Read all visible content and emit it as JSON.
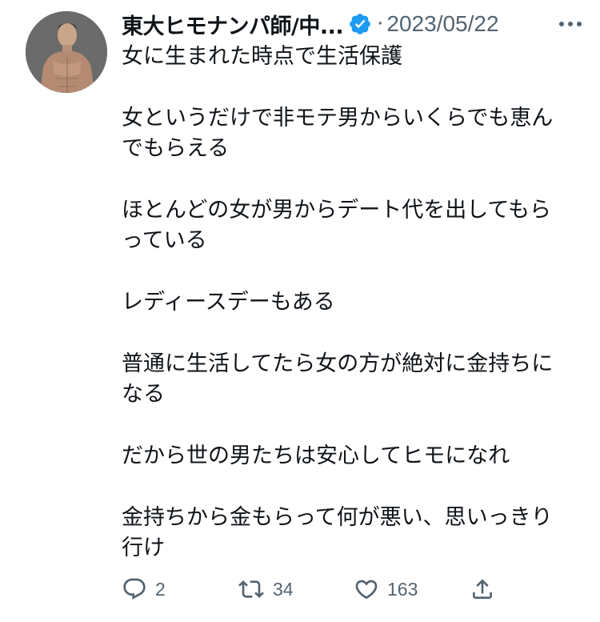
{
  "tweet": {
    "author_name": "東大ヒモナンパ師/中...",
    "separator": "·",
    "date": "2023/05/22",
    "verified_icon": "verified-badge-icon",
    "accent_color": "#1d9bf0",
    "paragraphs": [
      [
        "女に生まれた時点で生活保護"
      ],
      [
        "女というだけで非モテ男からいくらでも恵ん",
        "でもらえる"
      ],
      [
        "ほとんどの女が男からデート代を出してもら",
        "っている"
      ],
      [
        "レディースデーもある"
      ],
      [
        "普通に生活してたら女の方が絶対に金持ちに",
        "なる"
      ],
      [
        "だから世の男たちは安心してヒモになれ"
      ],
      [
        "金持ちから金もらって何が悪い、思いっきり",
        "行け"
      ]
    ],
    "actions": {
      "reply_count": "2",
      "retweet_count": "34",
      "like_count": "163"
    }
  }
}
